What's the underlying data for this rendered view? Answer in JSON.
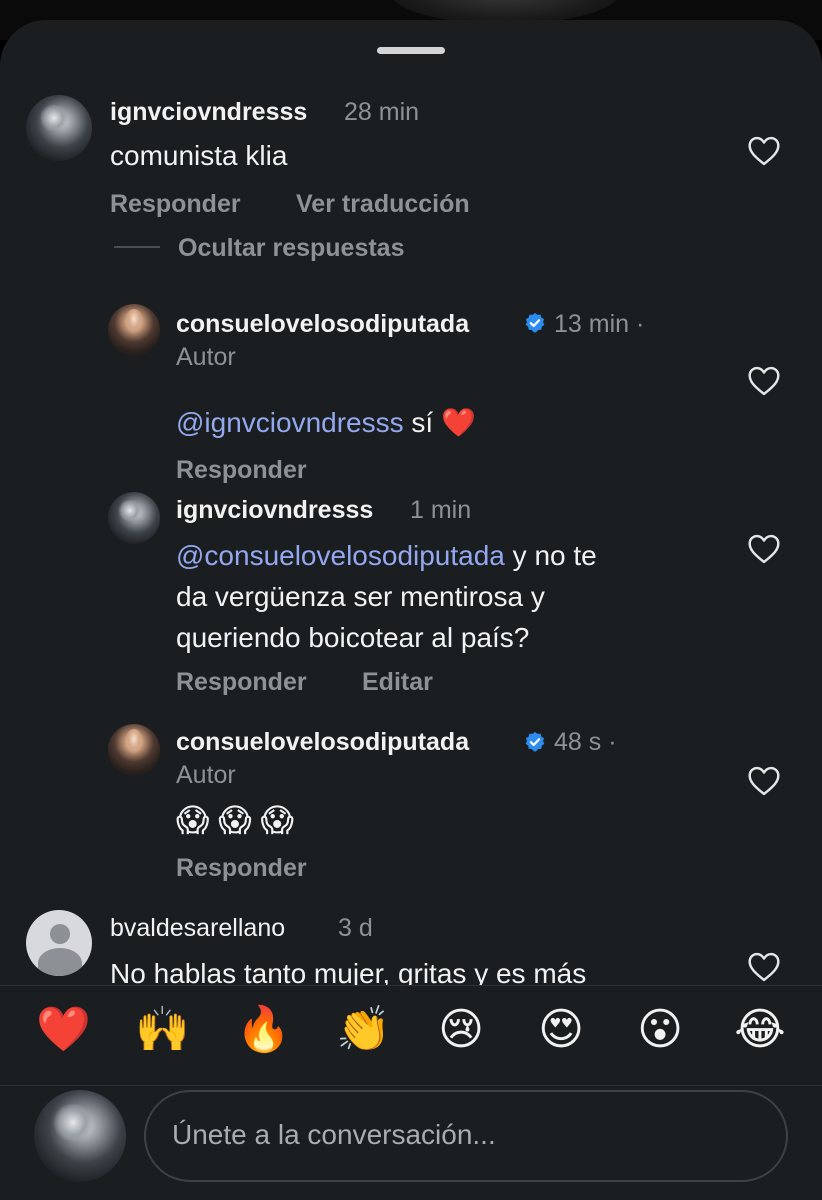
{
  "comments": [
    {
      "username": "ignvciovndresss",
      "time": "28 min",
      "text": "comunista klia",
      "actions": {
        "reply": "Responder",
        "translate": "Ver traducción"
      },
      "hide_replies": "Ocultar respuestas"
    }
  ],
  "replies": [
    {
      "username": "consuelovelosodiputada",
      "time": "13 min ·",
      "author_label": "Autor",
      "mention": "@ignvciovndresss",
      "text": " sí ",
      "emoji": "❤️",
      "reply": "Responder"
    },
    {
      "username": "ignvciovndresss",
      "time": "1 min",
      "mention": "@consuelovelosodiputada",
      "line1": " y no te",
      "line2": "da vergüenza ser mentirosa y",
      "line3": "queriendo boicotear al país?",
      "reply": "Responder",
      "edit": "Editar"
    },
    {
      "username": "consuelovelosodiputada",
      "time": "48 s ·",
      "author_label": "Autor",
      "text": "😱 😱 😱",
      "reply": "Responder"
    }
  ],
  "partial_comment": {
    "username": "bvaldesarellano",
    "time": "3 d",
    "text": "No hablas tanto mujer, gritas y es más"
  },
  "emoji_bar": [
    "❤️",
    "🙌",
    "🔥",
    "👏",
    "😢",
    "😍",
    "😮",
    "😂"
  ],
  "composer": {
    "placeholder": "Únete a la conversación..."
  },
  "colors": {
    "background": "#1b1e21",
    "mention": "#93a8ee",
    "verified": "#2d8cf0",
    "muted_text": "#8e9196"
  }
}
